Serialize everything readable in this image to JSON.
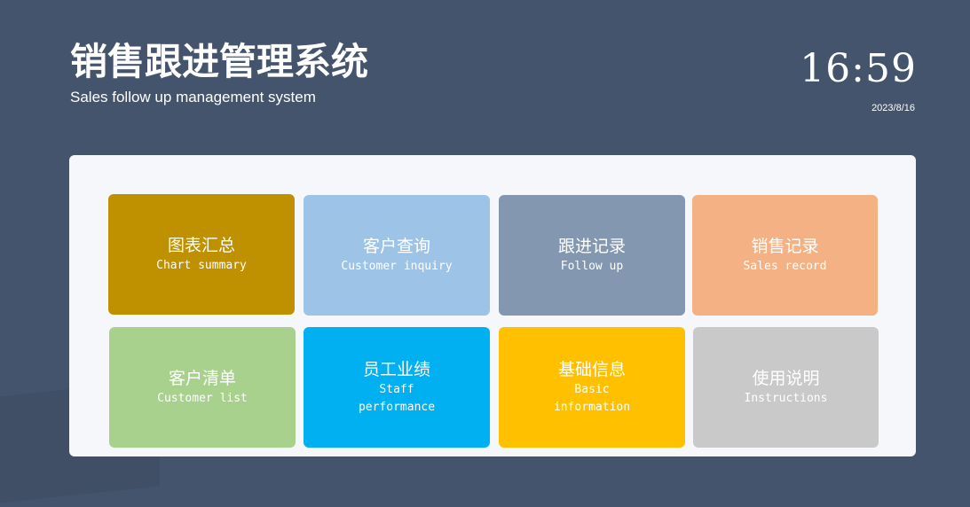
{
  "header": {
    "title": "销售跟进管理系统",
    "subtitle": "Sales follow up management system",
    "clock": "16:59",
    "date": "2023/8/16"
  },
  "tiles": [
    {
      "zh": "图表汇总",
      "en": "Chart summary",
      "color": "#bf9000",
      "icon": "chart-summary-tile"
    },
    {
      "zh": "客户查询",
      "en": "Customer inquiry",
      "color": "#9dc3e6",
      "icon": "customer-inquiry-tile"
    },
    {
      "zh": "跟进记录",
      "en": "Follow up",
      "color": "#8497b0",
      "icon": "follow-up-tile"
    },
    {
      "zh": "销售记录",
      "en": "Sales record",
      "color": "#f4b183",
      "icon": "sales-record-tile"
    },
    {
      "zh": "客户清单",
      "en": "Customer list",
      "color": "#a9d18e",
      "icon": "customer-list-tile"
    },
    {
      "zh": "员工业绩",
      "en": "Staff performance",
      "color": "#00b0f0",
      "icon": "staff-performance-tile"
    },
    {
      "zh": "基础信息",
      "en": "Basic information",
      "color": "#ffc000",
      "icon": "basic-information-tile"
    },
    {
      "zh": "使用说明",
      "en": "Instructions",
      "color": "#c9c9c9",
      "icon": "instructions-tile"
    }
  ]
}
